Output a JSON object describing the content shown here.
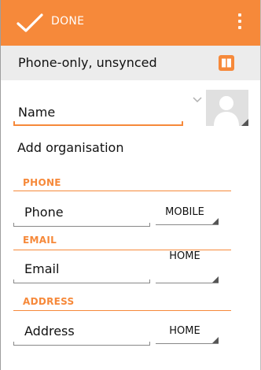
{
  "actionbar": {
    "done_label": "DONE",
    "done_icon": "checkmark-icon",
    "menu_icon": "overflow-menu-icon",
    "color": "#f6893a"
  },
  "account": {
    "label": "Phone-only, unsynced",
    "icon": "contact-book-icon"
  },
  "name": {
    "placeholder": "Name"
  },
  "add_organisation": "Add organisation",
  "sections": {
    "phone": {
      "title": "PHONE",
      "placeholder": "Phone",
      "type": "MOBILE"
    },
    "email": {
      "title": "EMAIL",
      "placeholder": "Email",
      "type": "HOME"
    },
    "address": {
      "title": "ADDRESS",
      "placeholder": "Address",
      "type": "HOME"
    }
  },
  "colors": {
    "accent": "#f6893a",
    "account_bar": "#ececec",
    "text": "#111111"
  }
}
